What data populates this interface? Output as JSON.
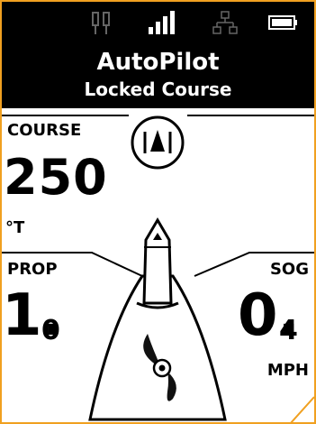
{
  "status": {
    "icons": [
      "dual-transducer-icon",
      "signal-strength-icon",
      "network-icon",
      "battery-icon"
    ]
  },
  "header": {
    "title": "AutoPilot",
    "subtitle": "Locked Course"
  },
  "course": {
    "label": "COURSE",
    "value": "250",
    "unit": "°T"
  },
  "prop": {
    "label": "PROP",
    "value_main": "1.",
    "value_small": "0"
  },
  "sog": {
    "label": "SOG",
    "value_main": "0.",
    "value_small": "4",
    "unit": "MPH"
  },
  "colors": {
    "frame": "#f0a020",
    "header_bg": "#000000",
    "body_bg": "#ffffff"
  }
}
